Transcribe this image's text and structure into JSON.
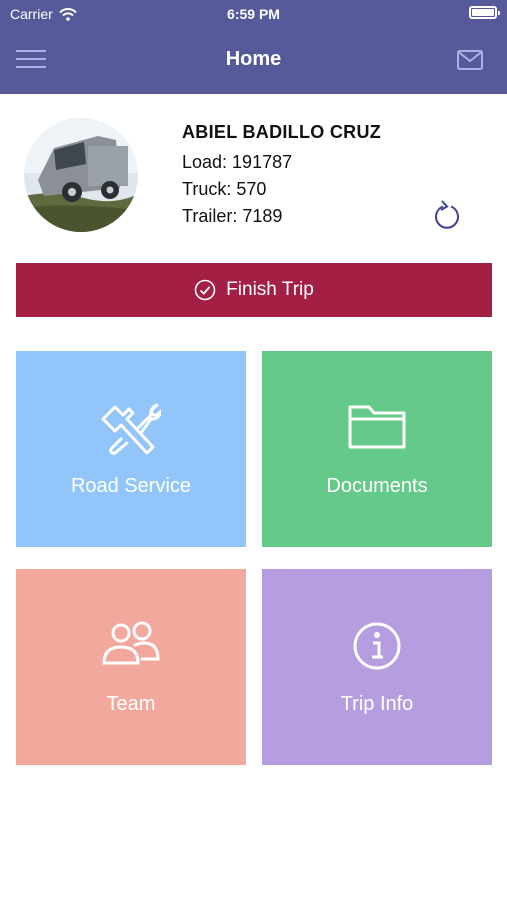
{
  "status_bar": {
    "carrier": "Carrier",
    "time": "6:59 PM"
  },
  "nav": {
    "title": "Home"
  },
  "driver": {
    "name": "ABIEL BADILLO CRUZ",
    "load": "Load: 191787",
    "truck": "Truck: 570",
    "trailer": "Trailer: 7189"
  },
  "actions": {
    "finish_trip": "Finish Trip"
  },
  "tiles": [
    {
      "label": "Road Service",
      "icon": "wrench-hammer-icon",
      "color": "#92c5f9"
    },
    {
      "label": "Documents",
      "icon": "folder-icon",
      "color": "#65c98a"
    },
    {
      "label": "Team",
      "icon": "people-icon",
      "color": "#f3a89e"
    },
    {
      "label": "Trip Info",
      "icon": "info-icon",
      "color": "#b69ddf"
    }
  ],
  "colors": {
    "header": "#565a9b",
    "finish_button": "#a31f44"
  }
}
